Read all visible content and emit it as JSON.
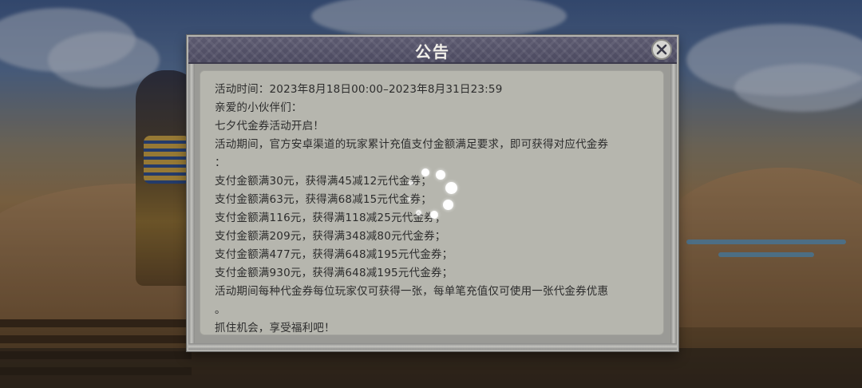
{
  "notice": {
    "title": "公告",
    "close_icon": "close-x-icon",
    "lines": [
      "活动时间：2023年8月18日00:00–2023年8月31日23:59",
      "亲爱的小伙伴们：",
      "七夕代金券活动开启！",
      "活动期间，官方安卓渠道的玩家累计充值支付金额满足要求，即可获得对应代金券",
      "：",
      "支付金额满30元，获得满45减12元代金券；",
      "支付金额满63元，获得满68减15元代金券；",
      "支付金额满116元，获得满118减25元代金券；",
      "支付金额满209元，获得满348减80元代金券；",
      "支付金额满477元，获得满648减195元代金券；",
      "支付金额满930元，获得满648减195元代金券；",
      "活动期间每种代金券每位玩家仅可获得一张，每单笔充值仅可使用一张代金券优惠",
      "。",
      "抓住机会，享受福利吧！"
    ]
  },
  "loading": {
    "icon": "loading-spinner-icon"
  }
}
